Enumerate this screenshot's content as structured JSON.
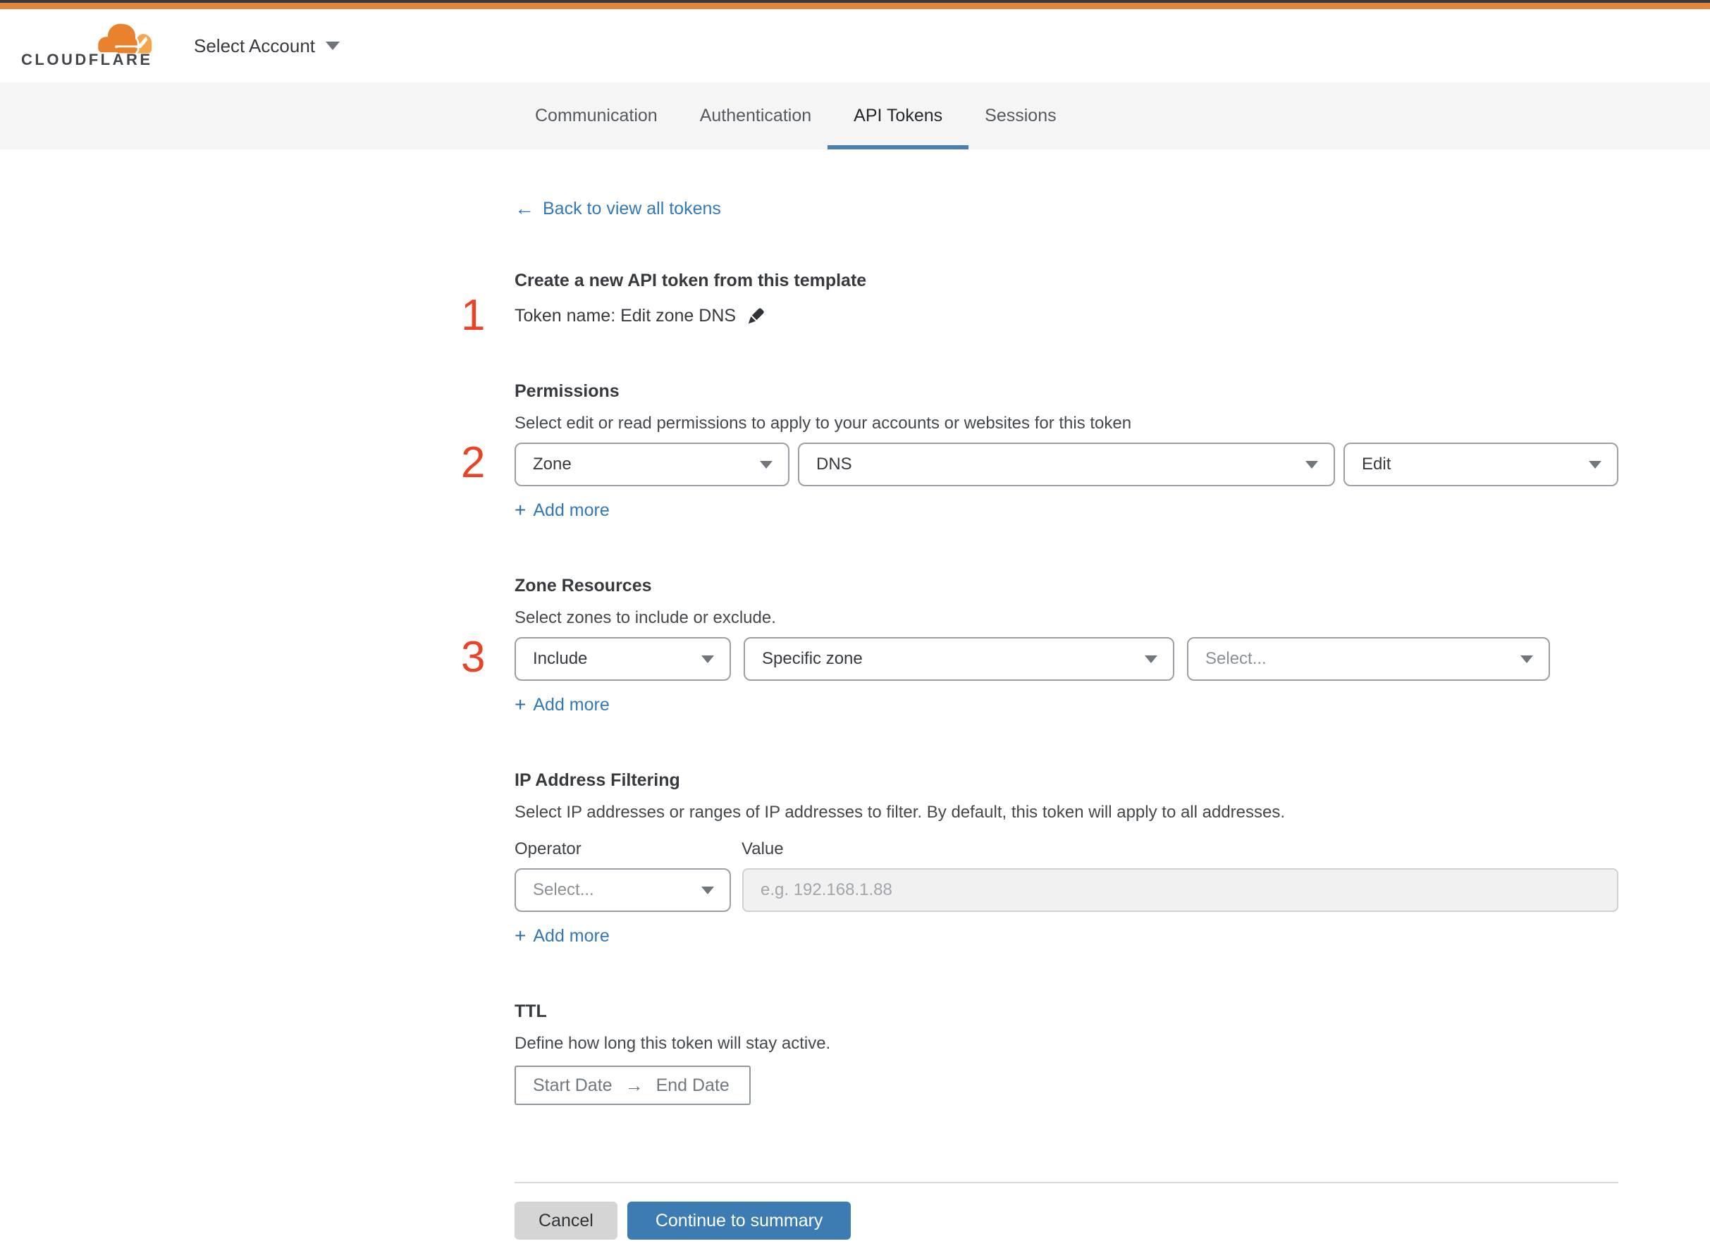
{
  "header": {
    "logo": "CLOUDFLARE",
    "account_selector": "Select Account"
  },
  "tabs": {
    "items": [
      "Communication",
      "Authentication",
      "API Tokens",
      "Sessions"
    ],
    "active": "API Tokens"
  },
  "back": {
    "arrow": "←",
    "label": "Back to view all tokens"
  },
  "intro": {
    "step": "1",
    "title": "Create a new API token from this template",
    "token_name": "Token name: Edit zone DNS"
  },
  "permissions": {
    "step": "2",
    "heading": "Permissions",
    "description": "Select edit or read permissions to apply to your accounts or websites for this token",
    "scope_value": "Zone",
    "resource_value": "DNS",
    "access_value": "Edit"
  },
  "zone_resources": {
    "step": "3",
    "heading": "Zone Resources",
    "description": "Select zones to include or exclude.",
    "mode_value": "Include",
    "type_value": "Specific zone",
    "zone_placeholder": "Select..."
  },
  "ip_filtering": {
    "heading": "IP Address Filtering",
    "description": "Select IP addresses or ranges of IP addresses to filter. By default, this token will apply to all addresses.",
    "operator_label": "Operator",
    "value_label": "Value",
    "operator_placeholder": "Select...",
    "value_placeholder": "e.g. 192.168.1.88"
  },
  "ttl": {
    "heading": "TTL",
    "description": "Define how long this token will stay active.",
    "start_label": "Start Date",
    "arrow": "→",
    "end_label": "End Date"
  },
  "add_more": {
    "plus": "+",
    "label": "Add more"
  },
  "footer": {
    "cancel": "Cancel",
    "continue": "Continue to summary"
  },
  "colors": {
    "top_bar_orange": "#e1873d",
    "logo_orange": "#e8822d",
    "logo_orange_light": "#f3a64c",
    "link_blue": "#3179b8",
    "tab_underline_blue": "#4a80ad",
    "step_marker_red": "#ea4426",
    "primary_button_blue": "#3d7cb2",
    "cancel_button_gray": "#d5d5d5"
  }
}
